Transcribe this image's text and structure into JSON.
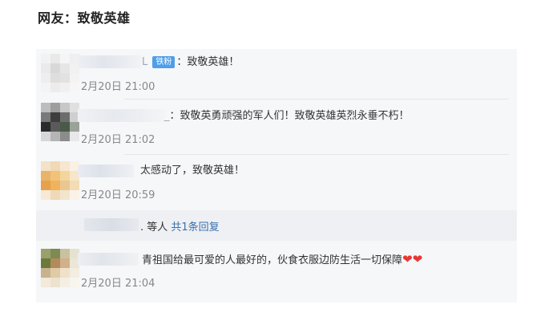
{
  "header": {
    "title": "网友：致敬英雄"
  },
  "comments": [
    {
      "name_tail": "L",
      "badge": "铁粉",
      "text": "：致敬英雄！",
      "time": "2月20日 21:00"
    },
    {
      "name_tail": "_",
      "text": "：致敬英勇顽强的军人们！致敬英雄英烈永垂不朽！",
      "time": "2月20日 21:02"
    },
    {
      "text": "太感动了，致敬英雄！",
      "time": "2月20日 20:59"
    },
    {
      "text": "青祖国给最可爱的人最好的，伙食衣服边防生活一切保障",
      "hearts": "❤❤",
      "time": "2月20日 21:04"
    }
  ],
  "replies": {
    "prefix": ". 等人 ",
    "link_label": "共1条回复"
  },
  "colors": {
    "badge_blue": "#4f9ee8",
    "link_blue": "#3a6fb0",
    "heart_red": "#e53935"
  }
}
